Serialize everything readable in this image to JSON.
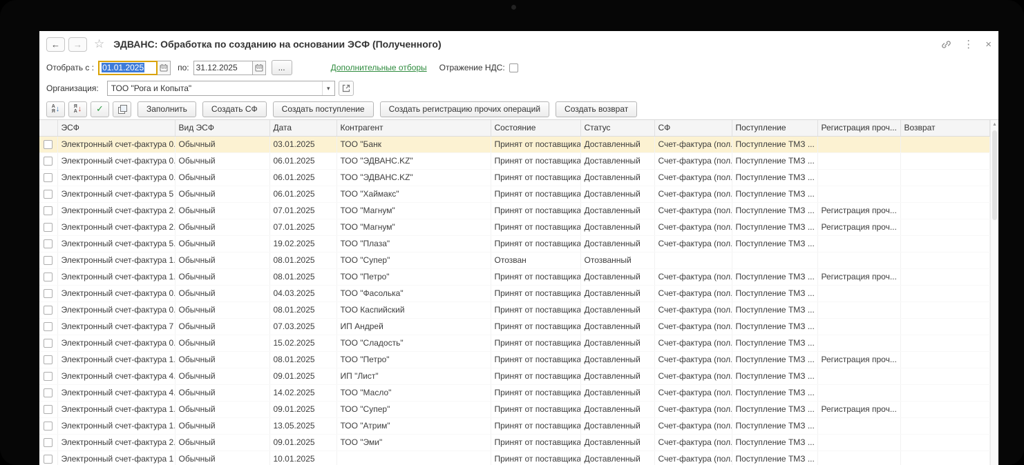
{
  "colors": {
    "link_green": "#2e8b3d",
    "selected_row": "#fcf2d2",
    "focus_border": "#d9a200",
    "selection_bg": "#3d7bd9",
    "header_bg": "#f5f5f5"
  },
  "icons": {
    "back": "←",
    "forward": "→",
    "favorite": "☆",
    "more_menu": "⋮",
    "close": "×",
    "dropdown": "▾",
    "scroll_up": "▲",
    "sort_az_top": "А",
    "sort_az_bottom": "Я",
    "sort_za_top": "Я",
    "sort_za_bottom": "А",
    "arrow_down": "↓",
    "check": "✓"
  },
  "window": {
    "title": "ЭДВАНС: Обработка по созданию на основании ЭСФ (Полученного)"
  },
  "filters": {
    "from_label": "Отобрать с :",
    "from_value": "01.01.2025",
    "to_label": "по:",
    "to_value": "31.12.2025",
    "more_filters": "...",
    "additional_link": "Дополнительные отборы",
    "vat_label": "Отражение НДС:",
    "vat_checked": false,
    "org_label": "Организация:",
    "org_value": "ТОО \"Рога и Копыта\""
  },
  "toolbar": {
    "buttons": [
      "Заполнить",
      "Создать СФ",
      "Создать поступление",
      "Создать регистрацию прочих операций",
      "Создать возврат"
    ]
  },
  "table": {
    "columns": [
      "ЭСФ",
      "Вид ЭСФ",
      "Дата",
      "Контрагент",
      "Состояние",
      "Статус",
      "СФ",
      "Поступление",
      "Регистрация проч...",
      "Возврат"
    ],
    "rows": [
      {
        "selected": true,
        "cells": [
          "Электронный счет-фактура 0...",
          "Обычный",
          "03.01.2025",
          "ТОО \"Банк",
          "Принят от поставщика",
          "Доставленный",
          "Счет-фактура (пол...",
          "Поступление ТМЗ ...",
          "",
          ""
        ]
      },
      {
        "selected": false,
        "cells": [
          "Электронный счет-фактура 0...",
          "Обычный",
          "06.01.2025",
          "ТОО \"ЭДВАНС.KZ\"",
          "Принят от поставщика",
          "Доставленный",
          "Счет-фактура (пол...",
          "Поступление ТМЗ ...",
          "",
          ""
        ]
      },
      {
        "selected": false,
        "cells": [
          "Электронный счет-фактура 0...",
          "Обычный",
          "06.01.2025",
          "ТОО \"ЭДВАНС.KZ\"",
          "Принят от поставщика",
          "Доставленный",
          "Счет-фактура (пол...",
          "Поступление ТМЗ ...",
          "",
          ""
        ]
      },
      {
        "selected": false,
        "cells": [
          "Электронный счет-фактура 5 ...",
          "Обычный",
          "06.01.2025",
          "ТОО \"Хаймакс\"",
          "Принят от поставщика",
          "Доставленный",
          "Счет-фактура (пол...",
          "Поступление ТМЗ ...",
          "",
          ""
        ]
      },
      {
        "selected": false,
        "cells": [
          "Электронный счет-фактура 2...",
          "Обычный",
          "07.01.2025",
          "ТОО \"Магнум\"",
          "Принят от поставщика",
          "Доставленный",
          "Счет-фактура (пол...",
          "Поступление ТМЗ ...",
          "Регистрация проч...",
          ""
        ]
      },
      {
        "selected": false,
        "cells": [
          "Электронный счет-фактура 2...",
          "Обычный",
          "07.01.2025",
          "ТОО \"Магнум\"",
          "Принят от поставщика",
          "Доставленный",
          "Счет-фактура (пол...",
          "Поступление ТМЗ ...",
          "Регистрация проч...",
          ""
        ]
      },
      {
        "selected": false,
        "cells": [
          "Электронный счет-фактура 5...",
          "Обычный",
          "19.02.2025",
          "ТОО \"Плаза\"",
          "Принят от поставщика",
          "Доставленный",
          "Счет-фактура (пол...",
          "Поступление ТМЗ ...",
          "",
          ""
        ]
      },
      {
        "selected": false,
        "cells": [
          "Электронный счет-фактура 1...",
          "Обычный",
          "08.01.2025",
          "ТОО \"Супер\"",
          "Отозван",
          "Отозванный",
          "",
          "",
          "",
          ""
        ]
      },
      {
        "selected": false,
        "cells": [
          "Электронный счет-фактура 1...",
          "Обычный",
          "08.01.2025",
          "ТОО \"Петро\"",
          "Принят от поставщика",
          "Доставленный",
          "Счет-фактура (пол...",
          "Поступление ТМЗ ...",
          "Регистрация проч...",
          ""
        ]
      },
      {
        "selected": false,
        "cells": [
          "Электронный счет-фактура 0...",
          "Обычный",
          "04.03.2025",
          "ТОО \"Фасолька\"",
          "Принят от поставщика",
          "Доставленный",
          "Счет-фактура (пол...",
          "Поступление ТМЗ ...",
          "",
          ""
        ]
      },
      {
        "selected": false,
        "cells": [
          "Электронный счет-фактура 0...",
          "Обычный",
          "08.01.2025",
          "ТОО Каспийский",
          "Принят от поставщика",
          "Доставленный",
          "Счет-фактура (пол...",
          "Поступление ТМЗ ...",
          "",
          ""
        ]
      },
      {
        "selected": false,
        "cells": [
          "Электронный счет-фактура 7 ...",
          "Обычный",
          "07.03.2025",
          "ИП Андрей",
          "Принят от поставщика",
          "Доставленный",
          "Счет-фактура (пол...",
          "Поступление ТМЗ ...",
          "",
          ""
        ]
      },
      {
        "selected": false,
        "cells": [
          "Электронный счет-фактура 0...",
          "Обычный",
          "15.02.2025",
          "ТОО \"Сладость\"",
          "Принят от поставщика",
          "Доставленный",
          "Счет-фактура (пол...",
          "Поступление ТМЗ ...",
          "",
          ""
        ]
      },
      {
        "selected": false,
        "cells": [
          "Электронный счет-фактура 1...",
          "Обычный",
          "08.01.2025",
          "ТОО \"Петро\"",
          "Принят от поставщика",
          "Доставленный",
          "Счет-фактура (пол...",
          "Поступление ТМЗ ...",
          "Регистрация проч...",
          ""
        ]
      },
      {
        "selected": false,
        "cells": [
          "Электронный счет-фактура 4...",
          "Обычный",
          "09.01.2025",
          "ИП \"Лист\"",
          "Принят от поставщика",
          "Доставленный",
          "Счет-фактура (пол...",
          "Поступление ТМЗ ...",
          "",
          ""
        ]
      },
      {
        "selected": false,
        "cells": [
          "Электронный счет-фактура 4...",
          "Обычный",
          "14.02.2025",
          "ТОО \"Масло\"",
          "Принят от поставщика",
          "Доставленный",
          "Счет-фактура (пол...",
          "Поступление ТМЗ ...",
          "",
          ""
        ]
      },
      {
        "selected": false,
        "cells": [
          "Электронный счет-фактура 1...",
          "Обычный",
          "09.01.2025",
          "ТОО \"Супер\"",
          "Принят от поставщика",
          "Доставленный",
          "Счет-фактура (пол...",
          "Поступление ТМЗ ...",
          "Регистрация проч...",
          ""
        ]
      },
      {
        "selected": false,
        "cells": [
          "Электронный счет-фактура 1...",
          "Обычный",
          "13.05.2025",
          "ТОО \"Атрим\"",
          "Принят от поставщика",
          "Доставленный",
          "Счет-фактура (пол...",
          "Поступление ТМЗ ...",
          "",
          ""
        ]
      },
      {
        "selected": false,
        "cells": [
          "Электронный счет-фактура 2...",
          "Обычный",
          "09.01.2025",
          "ТОО \"Эми\"",
          "Принят от поставщика",
          "Доставленный",
          "Счет-фактура (пол...",
          "Поступление ТМЗ ...",
          "",
          ""
        ]
      },
      {
        "selected": false,
        "cells": [
          "Электронный счет-фактура 1 ...",
          "Обычный",
          "10.01.2025",
          "",
          "Принят от поставщика",
          "Доставленный",
          "Счет-фактура (пол...",
          "Поступление ТМЗ ...",
          "",
          ""
        ]
      }
    ]
  }
}
